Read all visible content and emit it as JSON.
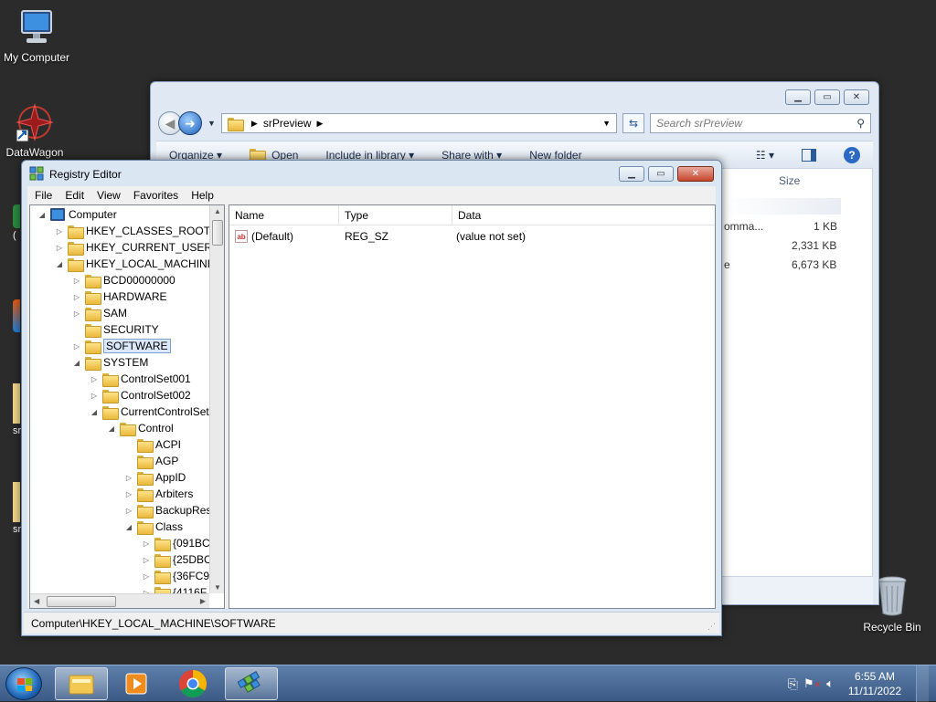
{
  "desktop": {
    "icons": [
      {
        "label": "My Computer"
      },
      {
        "label": "DataWagon"
      },
      {
        "label": "Recycle Bin"
      }
    ],
    "stub_labels": [
      "(",
      "C",
      "sr",
      "sr"
    ]
  },
  "explorer": {
    "breadcrumb": "srPreview",
    "search_placeholder": "Search srPreview",
    "commands": [
      "Organize ▾",
      "Open",
      "Include in library ▾",
      "Share with ▾",
      "New folder"
    ],
    "size_header": "Size",
    "rows": [
      {
        "type_partial": "omma...",
        "size": "1 KB"
      },
      {
        "type_partial": "",
        "size": "2,331 KB"
      },
      {
        "type_partial": "e",
        "size": "6,673 KB"
      }
    ]
  },
  "regedit": {
    "title": "Registry Editor",
    "menu": [
      "File",
      "Edit",
      "View",
      "Favorites",
      "Help"
    ],
    "tree": [
      {
        "label": "Computer",
        "depth": 0,
        "expander": "◢"
      },
      {
        "label": "HKEY_CLASSES_ROOT",
        "depth": 1,
        "expander": "▷"
      },
      {
        "label": "HKEY_CURRENT_USER",
        "depth": 1,
        "expander": "▷"
      },
      {
        "label": "HKEY_LOCAL_MACHINE",
        "depth": 1,
        "expander": "◢"
      },
      {
        "label": "BCD00000000",
        "depth": 2,
        "expander": "▷"
      },
      {
        "label": "HARDWARE",
        "depth": 2,
        "expander": "▷"
      },
      {
        "label": "SAM",
        "depth": 2,
        "expander": "▷"
      },
      {
        "label": "SECURITY",
        "depth": 2,
        "expander": ""
      },
      {
        "label": "SOFTWARE",
        "depth": 2,
        "expander": "▷",
        "selected": true
      },
      {
        "label": "SYSTEM",
        "depth": 2,
        "expander": "◢"
      },
      {
        "label": "ControlSet001",
        "depth": 3,
        "expander": "▷"
      },
      {
        "label": "ControlSet002",
        "depth": 3,
        "expander": "▷"
      },
      {
        "label": "CurrentControlSet",
        "depth": 3,
        "expander": "◢"
      },
      {
        "label": "Control",
        "depth": 4,
        "expander": "◢"
      },
      {
        "label": "ACPI",
        "depth": 5,
        "expander": ""
      },
      {
        "label": "AGP",
        "depth": 5,
        "expander": ""
      },
      {
        "label": "AppID",
        "depth": 5,
        "expander": "▷"
      },
      {
        "label": "Arbiters",
        "depth": 5,
        "expander": "▷"
      },
      {
        "label": "BackupRes",
        "depth": 5,
        "expander": "▷"
      },
      {
        "label": "Class",
        "depth": 5,
        "expander": "◢"
      },
      {
        "label": "{091BC",
        "depth": 6,
        "expander": "▷"
      },
      {
        "label": "{25DBC",
        "depth": 6,
        "expander": "▷"
      },
      {
        "label": "{36FC9I",
        "depth": 6,
        "expander": "▷"
      },
      {
        "label": "{4116F",
        "depth": 6,
        "expander": "▷"
      }
    ],
    "columns": [
      "Name",
      "Type",
      "Data"
    ],
    "values": [
      {
        "name": "(Default)",
        "type": "REG_SZ",
        "data": "(value not set)"
      }
    ],
    "status": "Computer\\HKEY_LOCAL_MACHINE\\SOFTWARE"
  },
  "taskbar": {
    "time": "6:55 AM",
    "date": "11/11/2022"
  }
}
